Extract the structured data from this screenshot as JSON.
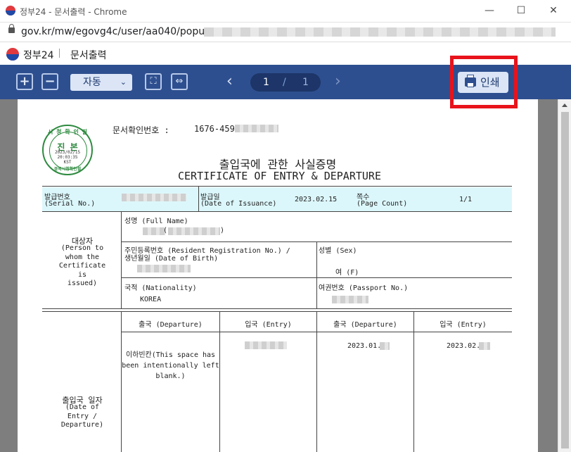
{
  "window": {
    "title": "정부24 - 문서출력 - Chrome",
    "controls": {
      "minimize": "—",
      "maximize": "☐",
      "close": "✕"
    }
  },
  "address_bar": {
    "url": "gov.kr/mw/egovg4c/user/aa040/popup"
  },
  "app_header": {
    "brand": "정부24",
    "page_title": "문서출력"
  },
  "toolbar": {
    "zoom_in": "+",
    "zoom_out": "−",
    "zoom_select_value": "자동",
    "zoom_chevron": "⌄",
    "fit_page": "⛶",
    "fit_width": "⇔",
    "prev_page": "‹",
    "next_page": "›",
    "current_page": "1",
    "page_separator": "/",
    "total_pages": "1",
    "print_label": "인쇄"
  },
  "document": {
    "confirm_no_label": "문서확인번호 :",
    "confirm_no_value": "1676-4590-",
    "seal": {
      "top_text": "시 청 확 인 필",
      "main_text": "진 본",
      "date": "2023/02/15",
      "time": "20:03:35",
      "tz": "KST",
      "bottom_text": "경복시청확인필"
    },
    "title_ko": "출입국에 관한 사실증명",
    "title_en": "CERTIFICATE OF ENTRY & DEPARTURE",
    "serial_label": "발급번호",
    "serial_label_en": "(Serial No.)",
    "issue_label": "발급일",
    "issue_label_en": "(Date of Issuance)",
    "issue_date": "2023.02.15",
    "page_label": "쪽수",
    "page_label_en": "(Page Count)",
    "page_count": "1/1",
    "subject_label": "대상자",
    "subject_label_en": "(Person to\nwhom the\nCertificate\nis\nissued)",
    "name_label": "성명 (Full Name)",
    "name_paren_open": "(",
    "name_paren_close": ")",
    "rrn_label": "주민등록번호 (Resident Registration No.) /",
    "rrn_label2": "생년월일 (Date of Birth)",
    "sex_label": "성별 (Sex)",
    "sex_value": "여 (F)",
    "nationality_label": "국적 (Nationality)",
    "nationality_value": "KOREA",
    "passport_label": "여권번호 (Passport No.)",
    "col_departure_1": "출국 (Departure)",
    "col_entry_1": "입국 (Entry)",
    "col_departure_2": "출국 (Departure)",
    "col_entry_2": "입국 (Entry)",
    "blank_note": "이하빈칸(This space has\nbeen intentionally left\nblank.)",
    "departure_date_2": "2023.01.",
    "entry_date_2": "2023.02.",
    "dates_label": "출입국 일자",
    "dates_label_en": "(Date of\nEntry /\nDeparture)"
  }
}
